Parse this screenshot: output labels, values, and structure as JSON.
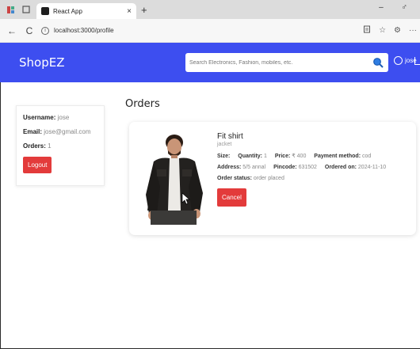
{
  "browser": {
    "tab_title": "React App",
    "tab_close": "×",
    "new_tab": "+",
    "window_controls": "– ♂",
    "url": "localhost:3000/profile",
    "back": "←",
    "reload": "C",
    "more": "···"
  },
  "header": {
    "brand": "ShopEZ",
    "search_placeholder": "Search Electronics, Fashion, mobiles, etc.",
    "username": "jose",
    "accent_color": "#3d4ef0"
  },
  "profile": {
    "username_label": "Username:",
    "username": "jose",
    "email_label": "Email:",
    "email": "jose@gmail.com",
    "orders_label": "Orders:",
    "orders_count": "1",
    "logout_label": "Logout"
  },
  "orders": {
    "title": "Orders",
    "items": [
      {
        "name": "Fit shirt",
        "description": "jacket",
        "size_label": "Size:",
        "size": "",
        "quantity_label": "Quantity:",
        "quantity": "1",
        "price_label": "Price:",
        "price": "₹ 400",
        "payment_label": "Payment method:",
        "payment": "cod",
        "address_label": "Address:",
        "address": "5/5 annal",
        "pincode_label": "Pincode:",
        "pincode": "631502",
        "ordered_label": "Ordered on:",
        "ordered_on": "2024-11-10",
        "status_label": "Order status:",
        "status": "order placed",
        "cancel_label": "Cancel"
      }
    ]
  }
}
